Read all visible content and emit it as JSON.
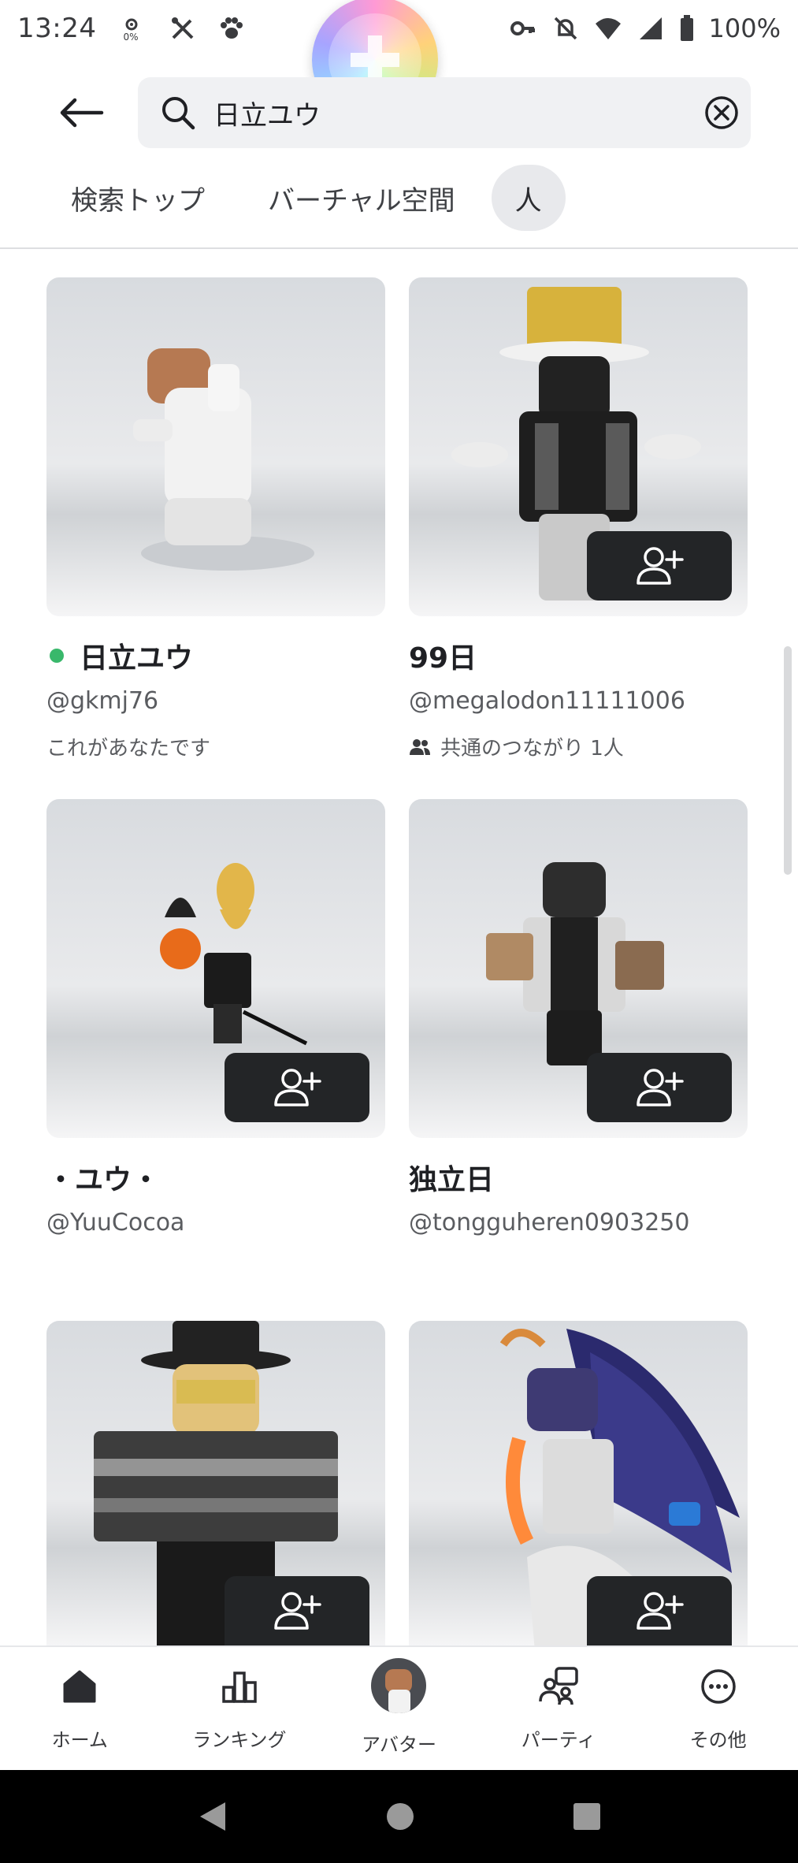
{
  "status_bar": {
    "time": "13:24",
    "data_usage": "0%",
    "battery": "100%"
  },
  "search": {
    "query": "日立ユウ"
  },
  "tabs": [
    {
      "label": "検索トップ"
    },
    {
      "label": "バーチャル空間"
    },
    {
      "label": "人"
    }
  ],
  "results": [
    {
      "display_name": "日立ユウ",
      "username": "@gkmj76",
      "subtext": "これがあなたです",
      "online": true
    },
    {
      "display_name": "99日",
      "username": "@megalodon11111006",
      "subtext": "共通のつながり 1人"
    },
    {
      "display_name": "・ユウ・",
      "username": "@YuuCocoa"
    },
    {
      "display_name": "独立日",
      "username": "@tongguheren0903250"
    },
    {
      "display_name": "",
      "username": ""
    },
    {
      "display_name": "",
      "username": ""
    }
  ],
  "bottom_nav": [
    {
      "label": "ホーム",
      "icon": "home-icon"
    },
    {
      "label": "ランキング",
      "icon": "chart-icon"
    },
    {
      "label": "アバター",
      "icon": "avatar-icon"
    },
    {
      "label": "パーティ",
      "icon": "party-icon"
    },
    {
      "label": "その他",
      "icon": "more-icon"
    }
  ],
  "colors": {
    "online": "#39b86b",
    "button_dark": "#232527",
    "tab_active_bg": "#e8e9ec"
  }
}
